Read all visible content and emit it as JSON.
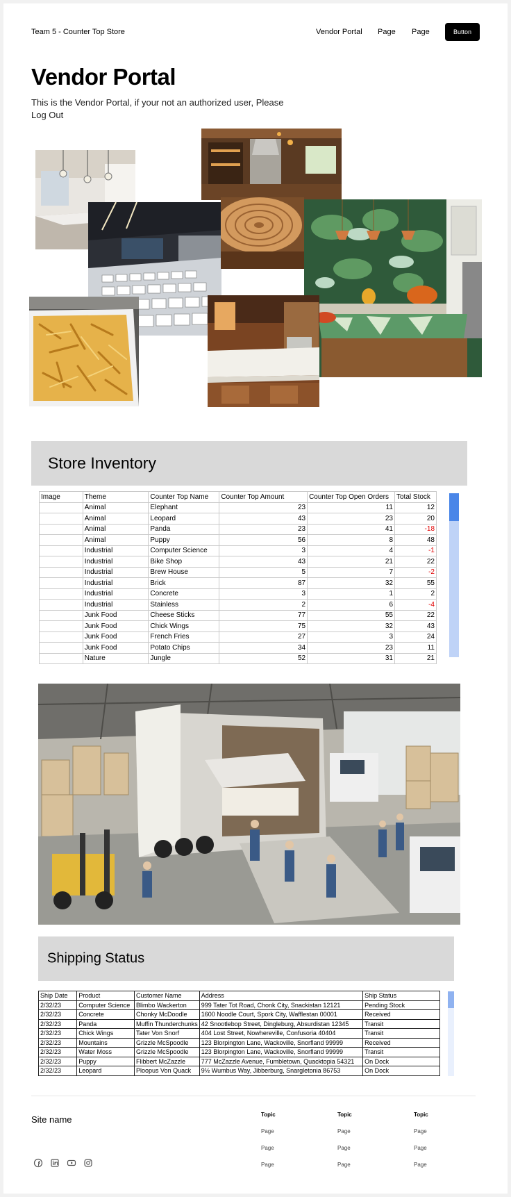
{
  "nav": {
    "brand": "Team 5 - Counter Top Store",
    "links": [
      "Vendor Portal",
      "Page",
      "Page"
    ],
    "button": "Button"
  },
  "hero": {
    "title": "Vendor Portal",
    "subtitle": "This is the Vendor Portal, if your not an authorized user, Please Log Out"
  },
  "inventory": {
    "title": "Store Inventory",
    "columns": [
      "Image",
      "Theme",
      "Counter Top Name",
      "Counter Top Amount",
      "Counter Top Open Orders",
      "Total Stock"
    ],
    "rows": [
      [
        "",
        "Animal",
        "Elephant",
        "23",
        "11",
        "12"
      ],
      [
        "",
        "Animal",
        "Leopard",
        "43",
        "23",
        "20"
      ],
      [
        "",
        "Animal",
        "Panda",
        "23",
        "41",
        "-18"
      ],
      [
        "",
        "Animal",
        "Puppy",
        "56",
        "8",
        "48"
      ],
      [
        "",
        "Industrial",
        "Computer Science",
        "3",
        "4",
        "-1"
      ],
      [
        "",
        "Industrial",
        "Bike Shop",
        "43",
        "21",
        "22"
      ],
      [
        "",
        "Industrial",
        "Brew House",
        "5",
        "7",
        "-2"
      ],
      [
        "",
        "Industrial",
        "Brick",
        "87",
        "32",
        "55"
      ],
      [
        "",
        "Industrial",
        "Concrete",
        "3",
        "1",
        "2"
      ],
      [
        "",
        "Industrial",
        "Stainless",
        "2",
        "6",
        "-4"
      ],
      [
        "",
        "Junk Food",
        "Cheese Sticks",
        "77",
        "55",
        "22"
      ],
      [
        "",
        "Junk Food",
        "Chick Wings",
        "75",
        "32",
        "43"
      ],
      [
        "",
        "Junk Food",
        "French Fries",
        "27",
        "3",
        "24"
      ],
      [
        "",
        "Junk Food",
        "Potato Chips",
        "34",
        "23",
        "11"
      ],
      [
        "",
        "Nature",
        "Jungle",
        "52",
        "31",
        "21"
      ]
    ]
  },
  "shipping": {
    "title": "Shipping Status",
    "columns": [
      "Ship Date",
      "Product",
      "Customer Name",
      "Address",
      "Ship Status"
    ],
    "rows": [
      [
        "2/32/23",
        "Computer Science",
        "Blimbo Wackerton",
        "999 Tater Tot Road, Chonk City, Snackistan 12121",
        "Pending Stock"
      ],
      [
        "2/32/23",
        "Concrete",
        "Chonky McDoodle",
        "1600 Noodle Court, Spork City, Wafflestan 00001",
        "Received"
      ],
      [
        "2/32/23",
        "Panda",
        "Muffin Thunderchunks",
        "42 Snootlebop Street, Dingleburg, Absurdistan 12345",
        "Transit"
      ],
      [
        "2/32/23",
        "Chick Wings",
        "Tater Von Snorf",
        "404 Lost Street, Nowhereville, Confusoria 40404",
        "Transit"
      ],
      [
        "2/32/23",
        "Mountains",
        "Grizzle McSpoodle",
        "123 Blorpington Lane, Wackoville, Snorfland 99999",
        "Received"
      ],
      [
        "2/32/23",
        "Water Moss",
        "Grizzle McSpoodle",
        "123 Blorpington Lane, Wackoville, Snorfland 99999",
        "Transit"
      ],
      [
        "2/32/23",
        "Puppy",
        "Flibbert McZazzle",
        "777 McZazzle Avenue, Fumbletown, Quacktopia 54321",
        "On Dock"
      ],
      [
        "2/32/23",
        "Leopard",
        "Ploopus Von Quack",
        "9½ Wumbus Way, Jibberburg, Snargletonia 86753",
        "On Dock"
      ]
    ]
  },
  "footer": {
    "site_name": "Site name",
    "social_icons": [
      "facebook-icon",
      "linkedin-icon",
      "youtube-icon",
      "instagram-icon"
    ],
    "columns": [
      {
        "topic": "Topic",
        "links": [
          "Page",
          "Page",
          "Page"
        ]
      },
      {
        "topic": "Topic",
        "links": [
          "Page",
          "Page",
          "Page"
        ]
      },
      {
        "topic": "Topic",
        "links": [
          "Page",
          "Page",
          "Page"
        ]
      }
    ]
  },
  "colors": {
    "header_gray": "#d9d9d9",
    "negative_red": "#e10000",
    "scroll_track": "#bfd3f7",
    "scroll_thumb": "#4a86e8"
  }
}
